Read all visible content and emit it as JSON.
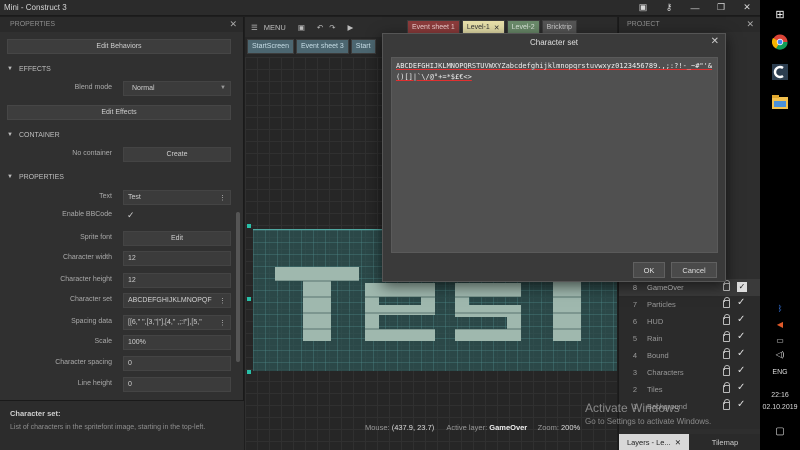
{
  "window": {
    "title": "Mini - Construct 3"
  },
  "left_panel": {
    "header": "PROPERTIES",
    "edit_behaviors": "Edit Behaviors",
    "effects_section": "EFFECTS",
    "blend_mode_label": "Blend mode",
    "blend_mode_value": "Normal",
    "edit_effects": "Edit Effects",
    "container_section": "CONTAINER",
    "container_label": "No container",
    "create_button": "Create",
    "properties_section": "PROPERTIES",
    "rows": [
      {
        "label": "Text",
        "value": "Test"
      },
      {
        "label": "Enable BBCode",
        "value": "✓"
      },
      {
        "label": "Sprite font",
        "value": "Edit"
      },
      {
        "label": "Character width",
        "value": "12"
      },
      {
        "label": "Character height",
        "value": "12"
      },
      {
        "label": "Character set",
        "value": "ABCDEFGHIJKLMNOPQF"
      },
      {
        "label": "Spacing data",
        "value": "[[6,\" \",[3,\"|\"],[4,\" ,;:!\"],[5,\""
      },
      {
        "label": "Scale",
        "value": "100%"
      },
      {
        "label": "Character spacing",
        "value": "0"
      },
      {
        "label": "Line height",
        "value": "0"
      }
    ],
    "description_title": "Character set:",
    "description_text": "List of characters in the spritefont image, starting in the top-left."
  },
  "center": {
    "menu_label": "MENU",
    "tabs_top": [
      {
        "label": "Event sheet 1",
        "style": "red"
      },
      {
        "label": "Level-1",
        "style": "yellow"
      },
      {
        "label": "Level-2",
        "style": "green"
      },
      {
        "label": "Bricktrip",
        "style": "gray"
      }
    ],
    "tabs_second": [
      "StartScreen",
      "Event sheet 3",
      "Start"
    ],
    "status": {
      "mouse_label": "Mouse:",
      "mouse_value": "(437.9, 23.7)",
      "layer_label": "Active layer:",
      "layer_value": "GameOver",
      "zoom_label": "Zoom:",
      "zoom_value": "200%"
    }
  },
  "right_panel": {
    "header": "PROJECT",
    "layers": [
      {
        "num": "8",
        "name": "GameOver",
        "selected": true
      },
      {
        "num": "7",
        "name": "Particles"
      },
      {
        "num": "6",
        "name": "HUD"
      },
      {
        "num": "5",
        "name": "Rain"
      },
      {
        "num": "4",
        "name": "Bound"
      },
      {
        "num": "3",
        "name": "Characters"
      },
      {
        "num": "2",
        "name": "Tiles"
      },
      {
        "num": "1",
        "name": "Background"
      }
    ],
    "bottom_tabs": [
      "Layers - Le...",
      "Tilemap"
    ]
  },
  "dialog": {
    "title": "Character set",
    "text": "ABCDEFGHIJKLMNOPQRSTUVWXYZabcdefghijklmnopqrstuvwxyz0123456789.,;:?!-_~#\"'&()[]|`\\/@°+=*$£€<>",
    "ok": "OK",
    "cancel": "Cancel"
  },
  "taskbar": {
    "language": "ENG",
    "time": "22:16",
    "date": "02.10.2019"
  },
  "watermark": {
    "line1": "Activate Windows",
    "line2": "Go to Settings to activate Windows."
  },
  "colors": {
    "canvas_teal": "#306464",
    "pixel_text": "#9fb8ae",
    "dialog_bg": "#3a3a3a"
  }
}
